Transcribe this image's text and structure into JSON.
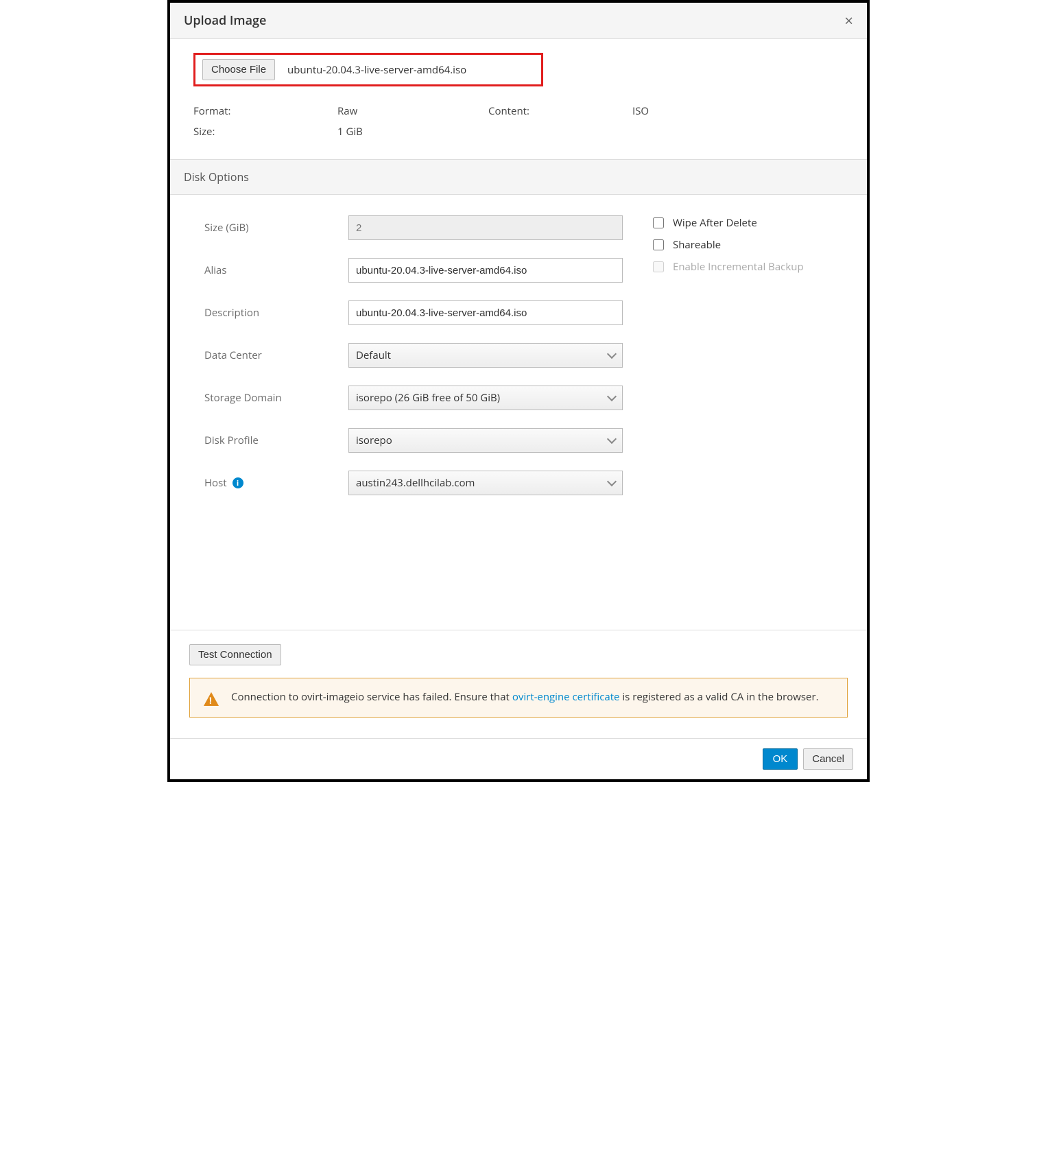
{
  "dialog": {
    "title": "Upload Image",
    "close": "×"
  },
  "file": {
    "choose_label": "Choose File",
    "filename": "ubuntu-20.04.3-live-server-amd64.iso",
    "format_label": "Format:",
    "format_value": "Raw",
    "content_label": "Content:",
    "content_value": "ISO",
    "size_label": "Size:",
    "size_value": "1 GiB"
  },
  "disk_options": {
    "section_title": "Disk Options",
    "size_label": "Size (GiB)",
    "size_value": "2",
    "alias_label": "Alias",
    "alias_value": "ubuntu-20.04.3-live-server-amd64.iso",
    "description_label": "Description",
    "description_value": "ubuntu-20.04.3-live-server-amd64.iso",
    "data_center_label": "Data Center",
    "data_center_value": "Default",
    "storage_domain_label": "Storage Domain",
    "storage_domain_value": "isorepo (26 GiB free of 50 GiB)",
    "disk_profile_label": "Disk Profile",
    "disk_profile_value": "isorepo",
    "host_label": "Host",
    "host_value": "austin243.dellhcilab.com",
    "wipe_label": "Wipe After Delete",
    "shareable_label": "Shareable",
    "incremental_label": "Enable Incremental Backup"
  },
  "test": {
    "button_label": "Test Connection"
  },
  "alert": {
    "text_before": "Connection to ovirt-imageio service has failed. Ensure that ",
    "link_text": "ovirt-engine certificate",
    "text_after": " is registered as a valid CA in the browser."
  },
  "footer": {
    "ok": "OK",
    "cancel": "Cancel"
  }
}
